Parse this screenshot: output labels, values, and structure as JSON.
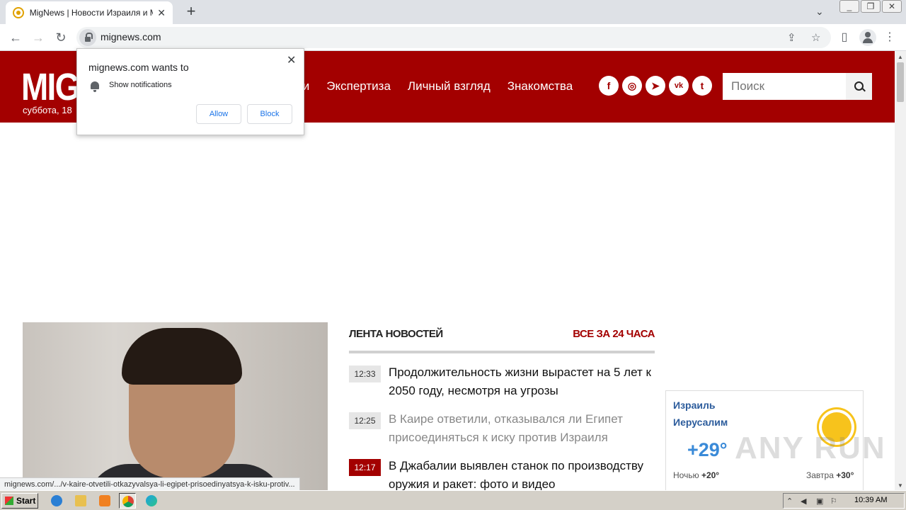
{
  "browser": {
    "tab_title": "MigNews | Новости Израиля и Мира",
    "tab_close": "✕",
    "new_tab": "+",
    "url": "mignews.com",
    "window_buttons": [
      "_",
      "❐",
      "✕"
    ],
    "tab_menu": "⌄"
  },
  "site": {
    "logo": "MIG",
    "date": "суббота, 18",
    "nav": [
      "ти",
      "Экспертиза",
      "Личный взгляд",
      "Знакомства"
    ],
    "socials": [
      "f",
      "◎",
      "➤",
      "vk",
      "t"
    ],
    "search_placeholder": "Поиск"
  },
  "notification": {
    "title": "mignews.com wants to",
    "permission": "Show notifications",
    "allow": "Allow",
    "block": "Block",
    "close": "✕"
  },
  "feed": {
    "title": "ЛЕНТА НОВОСТЕЙ",
    "all_link": "ВСЕ ЗА 24 ЧАСА",
    "items": [
      {
        "time": "12:33",
        "text": "Продолжительность жизни вырастет на 5 лет к 2050 году, несмотря на угрозы"
      },
      {
        "time": "12:25",
        "text": "В Каире ответили, отказывался ли Египет присоединяться к иску против Израиля"
      },
      {
        "time": "12:17",
        "text": "В Джабалии выявлен станок по производству оружия и ракет: фото и видео"
      }
    ]
  },
  "weather": {
    "country": "Израиль",
    "city": "Иерусалим",
    "temp": "+29°",
    "night_label": "Ночью",
    "night_temp": "+20°",
    "tomorrow_label": "Завтра",
    "tomorrow_temp": "+30°"
  },
  "watermark": "ANY RUN",
  "status_url": "mignews.com/.../v-kaire-otvetili-otkazyvalsya-li-egipet-prisoedinyatsya-k-isku-protiv...",
  "taskbar": {
    "start": "Start",
    "clock": "10:39 AM"
  },
  "colors": {
    "brand_red": "#a30000",
    "weather_blue": "#2c5c9c"
  }
}
